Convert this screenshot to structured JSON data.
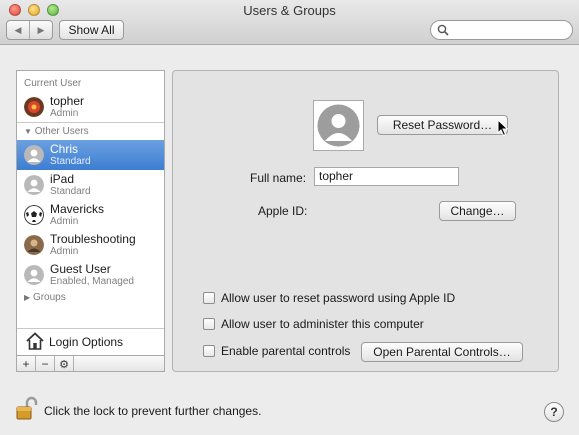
{
  "window": {
    "title": "Users & Groups"
  },
  "toolbar": {
    "back_icon": "back-arrow-icon",
    "forward_icon": "forward-arrow-icon",
    "show_all_label": "Show All",
    "search_placeholder": ""
  },
  "sidebar": {
    "current_user_header": "Current User",
    "current_user": {
      "name": "topher",
      "role": "Admin",
      "icon": "avatar-flower"
    },
    "other_users_header": "Other Users",
    "users": [
      {
        "name": "Chris",
        "role": "Standard",
        "selected": true,
        "icon": "avatar-generic"
      },
      {
        "name": "iPad",
        "role": "Standard",
        "icon": "avatar-generic"
      },
      {
        "name": "Mavericks",
        "role": "Admin",
        "icon": "avatar-soccer-ball"
      },
      {
        "name": "Troubleshooting",
        "role": "Admin",
        "icon": "avatar-photo"
      },
      {
        "name": "Guest User",
        "role": "Enabled, Managed",
        "icon": "avatar-generic"
      }
    ],
    "groups_header": "Groups",
    "login_options_label": "Login Options",
    "add_label": "+",
    "remove_label": "−",
    "action_icon": "gear-icon"
  },
  "detail": {
    "reset_password_label": "Reset Password…",
    "full_name_label": "Full name:",
    "full_name_value": "topher",
    "apple_id_label": "Apple ID:",
    "change_label": "Change…",
    "checkboxes": [
      {
        "label": "Allow user to reset password using Apple ID",
        "checked": false
      },
      {
        "label": "Allow user to administer this computer",
        "checked": false
      },
      {
        "label": "Enable parental controls",
        "checked": false
      }
    ],
    "open_parental_label": "Open Parental Controls…"
  },
  "footer": {
    "lock_text": "Click the lock to prevent further changes.",
    "help_label": "?"
  },
  "colors": {
    "selection": "#3d7ed2",
    "window_bg": "#ececec"
  }
}
